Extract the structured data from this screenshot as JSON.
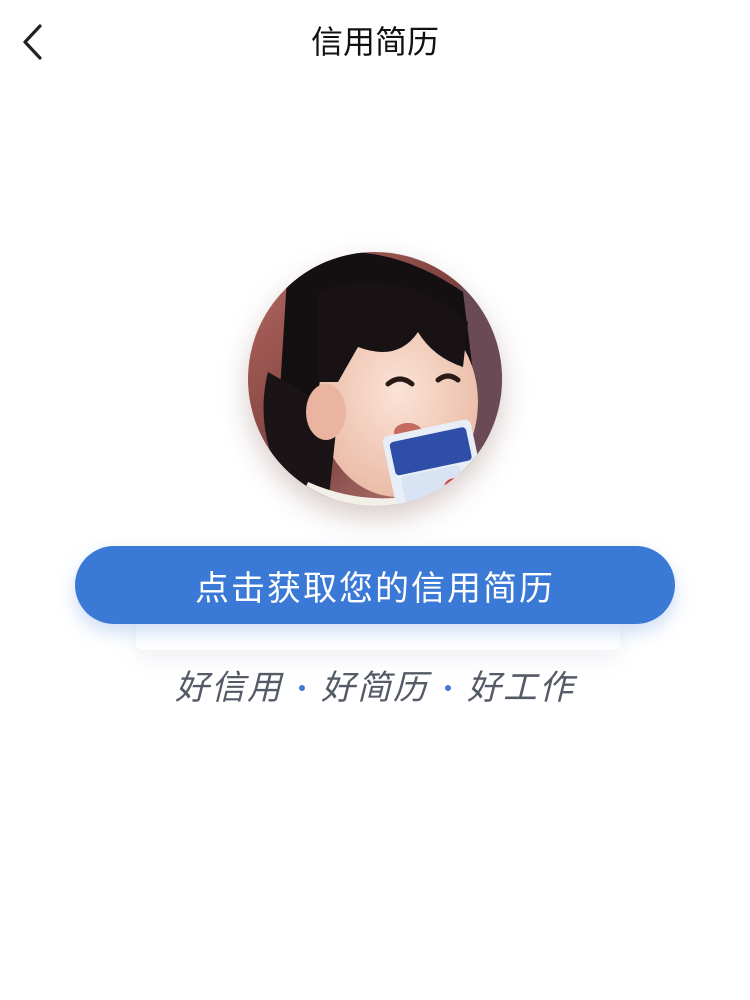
{
  "navbar": {
    "title": "信用简历",
    "back_icon": "chevron-left-icon"
  },
  "avatar": {
    "icon": "user-avatar-photo"
  },
  "cta": {
    "label": "点击获取您的信用简历",
    "color": "#3a79d6"
  },
  "slogan": {
    "items": [
      "好信用",
      "好简历",
      "好工作"
    ],
    "separator_color": "#3a79d6"
  }
}
